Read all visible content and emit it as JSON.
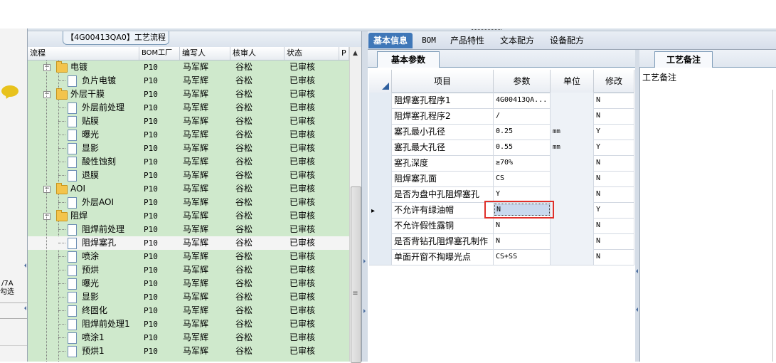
{
  "tree": {
    "title": "【4G00413QA0】工艺流程",
    "columns": [
      "流程",
      "BOM工厂",
      "编写人",
      "核审人",
      "状态",
      "P"
    ],
    "rows": [
      {
        "name": "电镀",
        "type": "folder",
        "level": 1,
        "bom": "P10",
        "writer": "马军辉",
        "reviewer": "谷松",
        "status": "已审核"
      },
      {
        "name": "负片电镀",
        "type": "doc",
        "level": 2,
        "bom": "P10",
        "writer": "马军辉",
        "reviewer": "谷松",
        "status": "已审核"
      },
      {
        "name": "外层干膜",
        "type": "folder",
        "level": 1,
        "bom": "P10",
        "writer": "马军辉",
        "reviewer": "谷松",
        "status": "已审核"
      },
      {
        "name": "外层前处理",
        "type": "doc",
        "level": 2,
        "bom": "P10",
        "writer": "马军辉",
        "reviewer": "谷松",
        "status": "已审核"
      },
      {
        "name": "贴膜",
        "type": "doc",
        "level": 2,
        "bom": "P10",
        "writer": "马军辉",
        "reviewer": "谷松",
        "status": "已审核"
      },
      {
        "name": "曝光",
        "type": "doc",
        "level": 2,
        "bom": "P10",
        "writer": "马军辉",
        "reviewer": "谷松",
        "status": "已审核"
      },
      {
        "name": "显影",
        "type": "doc",
        "level": 2,
        "bom": "P10",
        "writer": "马军辉",
        "reviewer": "谷松",
        "status": "已审核"
      },
      {
        "name": "酸性蚀刻",
        "type": "doc",
        "level": 2,
        "bom": "P10",
        "writer": "马军辉",
        "reviewer": "谷松",
        "status": "已审核"
      },
      {
        "name": "退膜",
        "type": "doc",
        "level": 2,
        "bom": "P10",
        "writer": "马军辉",
        "reviewer": "谷松",
        "status": "已审核"
      },
      {
        "name": "AOI",
        "type": "folder",
        "level": 1,
        "bom": "P10",
        "writer": "马军辉",
        "reviewer": "谷松",
        "status": "已审核"
      },
      {
        "name": "外层AOI",
        "type": "doc",
        "level": 2,
        "bom": "P10",
        "writer": "马军辉",
        "reviewer": "谷松",
        "status": "已审核"
      },
      {
        "name": "阻焊",
        "type": "folder",
        "level": 1,
        "bom": "P10",
        "writer": "马军辉",
        "reviewer": "谷松",
        "status": "已审核"
      },
      {
        "name": "阻焊前处理",
        "type": "doc",
        "level": 2,
        "bom": "P10",
        "writer": "马军辉",
        "reviewer": "谷松",
        "status": "已审核"
      },
      {
        "name": "阻焊塞孔",
        "type": "doc",
        "level": 2,
        "bom": "P10",
        "writer": "马军辉",
        "reviewer": "谷松",
        "status": "已审核",
        "selected": true
      },
      {
        "name": "喷涂",
        "type": "doc",
        "level": 2,
        "bom": "P10",
        "writer": "马军辉",
        "reviewer": "谷松",
        "status": "已审核"
      },
      {
        "name": "预烘",
        "type": "doc",
        "level": 2,
        "bom": "P10",
        "writer": "马军辉",
        "reviewer": "谷松",
        "status": "已审核"
      },
      {
        "name": "曝光",
        "type": "doc",
        "level": 2,
        "bom": "P10",
        "writer": "马军辉",
        "reviewer": "谷松",
        "status": "已审核"
      },
      {
        "name": "显影",
        "type": "doc",
        "level": 2,
        "bom": "P10",
        "writer": "马军辉",
        "reviewer": "谷松",
        "status": "已审核"
      },
      {
        "name": "终固化",
        "type": "doc",
        "level": 2,
        "bom": "P10",
        "writer": "马军辉",
        "reviewer": "谷松",
        "status": "已审核"
      },
      {
        "name": "阻焊前处理1",
        "type": "doc",
        "level": 2,
        "bom": "P10",
        "writer": "马军辉",
        "reviewer": "谷松",
        "status": "已审核"
      },
      {
        "name": "喷涂1",
        "type": "doc",
        "level": 2,
        "bom": "P10",
        "writer": "马军辉",
        "reviewer": "谷松",
        "status": "已审核"
      },
      {
        "name": "预烘1",
        "type": "doc",
        "level": 2,
        "bom": "P10",
        "writer": "马军辉",
        "reviewer": "谷松",
        "status": "已审核"
      }
    ]
  },
  "left_strip": {
    "line1": "/7A",
    "line2": "勾选"
  },
  "tabs": [
    "基本信息",
    "BOM",
    "产品特性",
    "文本配方",
    "设备配方"
  ],
  "params": {
    "subtab": "基本参数",
    "columns": [
      "项目",
      "参数",
      "单位",
      "修改"
    ],
    "rows": [
      {
        "item": "阻焊塞孔程序1",
        "param": "4G00413QA...",
        "unit": "",
        "modify": "N"
      },
      {
        "item": "阻焊塞孔程序2",
        "param": "/",
        "unit": "",
        "modify": "N"
      },
      {
        "item": "塞孔最小孔径",
        "param": "0.25",
        "unit": "mm",
        "modify": "Y"
      },
      {
        "item": "塞孔最大孔径",
        "param": "0.55",
        "unit": "mm",
        "modify": "Y"
      },
      {
        "item": "塞孔深度",
        "param": "≥70%",
        "unit": "",
        "modify": "N"
      },
      {
        "item": "阻焊塞孔面",
        "param": "CS",
        "unit": "",
        "modify": "N"
      },
      {
        "item": "是否为盘中孔阻焊塞孔",
        "param": "Y",
        "unit": "",
        "modify": "N"
      },
      {
        "item": "不允许有绿油帽",
        "param": "N",
        "unit": "",
        "modify": "Y",
        "current": true
      },
      {
        "item": "不允许假性露铜",
        "param": "N",
        "unit": "",
        "modify": "N"
      },
      {
        "item": "是否背钻孔阻焊塞孔制作",
        "param": "N",
        "unit": "",
        "modify": "N"
      },
      {
        "item": "单面开窗不掏曝光点",
        "param": "CS+SS",
        "unit": "",
        "modify": "N"
      }
    ]
  },
  "notes": {
    "tab": "工艺备注",
    "label": "工艺备注"
  },
  "colors": {
    "tree_bg": "#cfe9cc",
    "tab_active": "#3f77b8",
    "highlight": "#e0302a"
  }
}
